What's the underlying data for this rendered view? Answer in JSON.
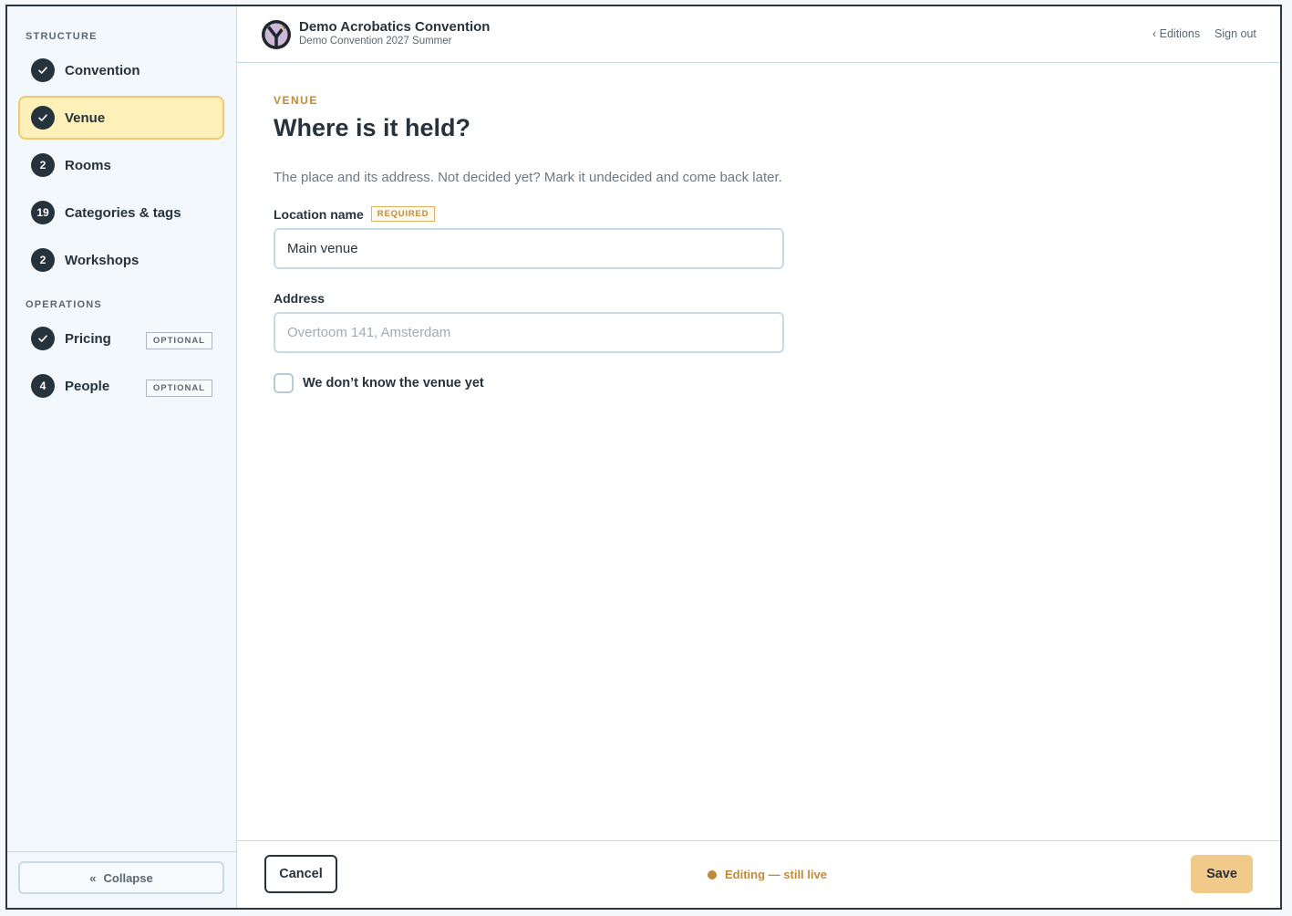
{
  "sidebar": {
    "structure_label": "STRUCTURE",
    "operations_label": "OPERATIONS",
    "items": [
      {
        "label": "Convention",
        "badge": "",
        "done": true
      },
      {
        "label": "Venue",
        "badge": "",
        "done": true,
        "active": true
      },
      {
        "label": "Rooms",
        "badge": "2"
      },
      {
        "label": "Categories & tags",
        "badge": "19"
      },
      {
        "label": "Workshops",
        "badge": "2"
      },
      {
        "label": "Pricing",
        "badge": "",
        "done": true,
        "tag": "OPTIONAL"
      },
      {
        "label": "People",
        "badge": "4",
        "tag": "OPTIONAL"
      }
    ],
    "collapse_label": "Collapse",
    "collapse_icon": "«"
  },
  "header": {
    "org_name": "Demo Acrobatics Convention",
    "edition_name": "Demo Convention 2027 Summer",
    "editions_link": "‹ Editions",
    "signout_link": "Sign out"
  },
  "form": {
    "eyebrow": "VENUE",
    "title": "Where is it held?",
    "description": "The place and its address. Not decided yet? Mark it undecided and come back later.",
    "location_label": "Location name",
    "required_tag": "REQUIRED",
    "location_value": "Main venue",
    "address_label": "Address",
    "address_placeholder": "Overtoom 141, Amsterdam",
    "undecided_label": "We don’t know the venue yet",
    "undecided_checked": false
  },
  "footer": {
    "cancel_label": "Cancel",
    "status_text": "Editing — still live",
    "save_label": "Save"
  },
  "colors": {
    "accent": "#c1893a",
    "active_bg": "#fdf1b9",
    "dark": "#26323c",
    "save_bg": "#f1c98a"
  }
}
